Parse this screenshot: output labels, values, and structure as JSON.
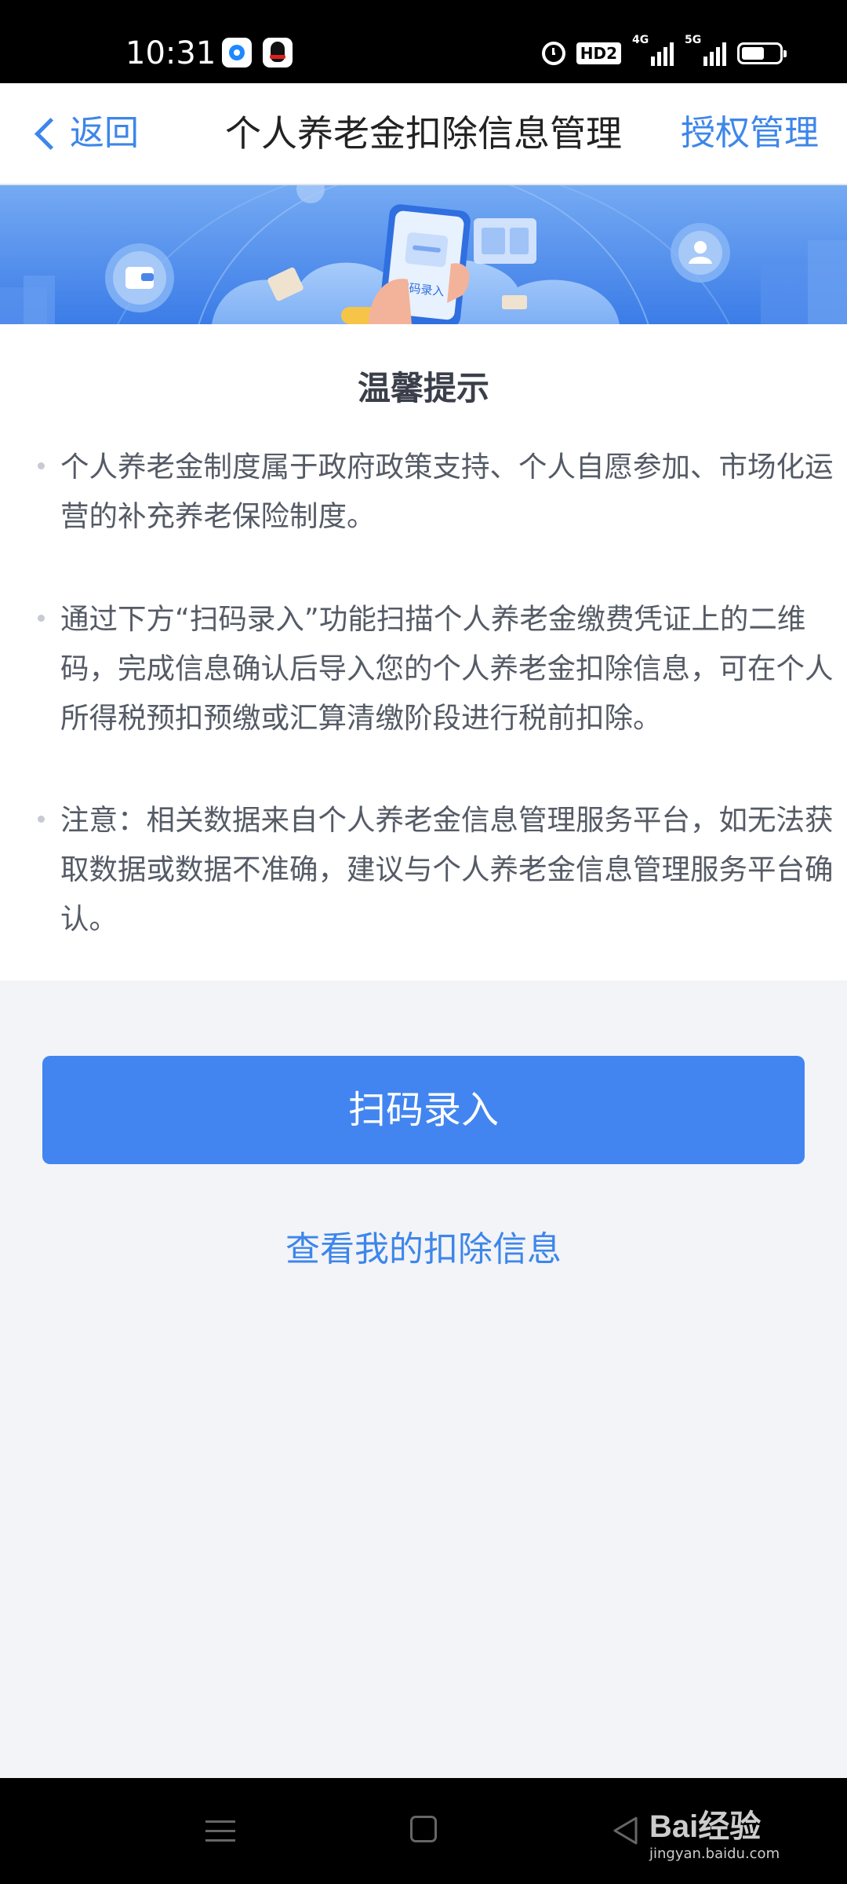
{
  "status_bar": {
    "time": "10:31",
    "hd_label": "HD2",
    "signal1_label": "4G",
    "signal2_label": "5G",
    "icons": [
      "browser-app-icon",
      "qq-app-icon",
      "alarm-icon",
      "signal-icon",
      "battery-icon"
    ]
  },
  "nav": {
    "back_label": "返回",
    "title": "个人养老金扣除信息管理",
    "right_label": "授权管理"
  },
  "banner": {
    "phone_label": "扫码录入",
    "colors": {
      "top": "#6fa5f2",
      "bottom": "#3a7be8"
    }
  },
  "tips": {
    "title": "温馨提示",
    "items": [
      {
        "text": "个人养老金制度属于政府政策支持、个人自愿参加、市场化运营的补充养老保险制度。"
      },
      {
        "text": "通过下方“扫码录入”功能扫描个人养老金缴费凭证上的二维码，完成信息确认后导入您的个人养老金扣除信息，可在个人所得税预扣预缴或汇算清缴阶段进行税前扣除。"
      },
      {
        "text": "注意：相关数据来自个人养老金信息管理服务平台，如无法获取数据或数据不准确，建议与个人养老金信息管理服务平台确认。"
      }
    ]
  },
  "actions": {
    "scan_button": "扫码录入",
    "view_link": "查看我的扣除信息"
  },
  "watermark": {
    "brand": "Bai经验",
    "url": "jingyan.baidu.com"
  },
  "theme": {
    "accent": "#3d86ea",
    "button": "#4285f0",
    "background": "#f3f4f8"
  }
}
